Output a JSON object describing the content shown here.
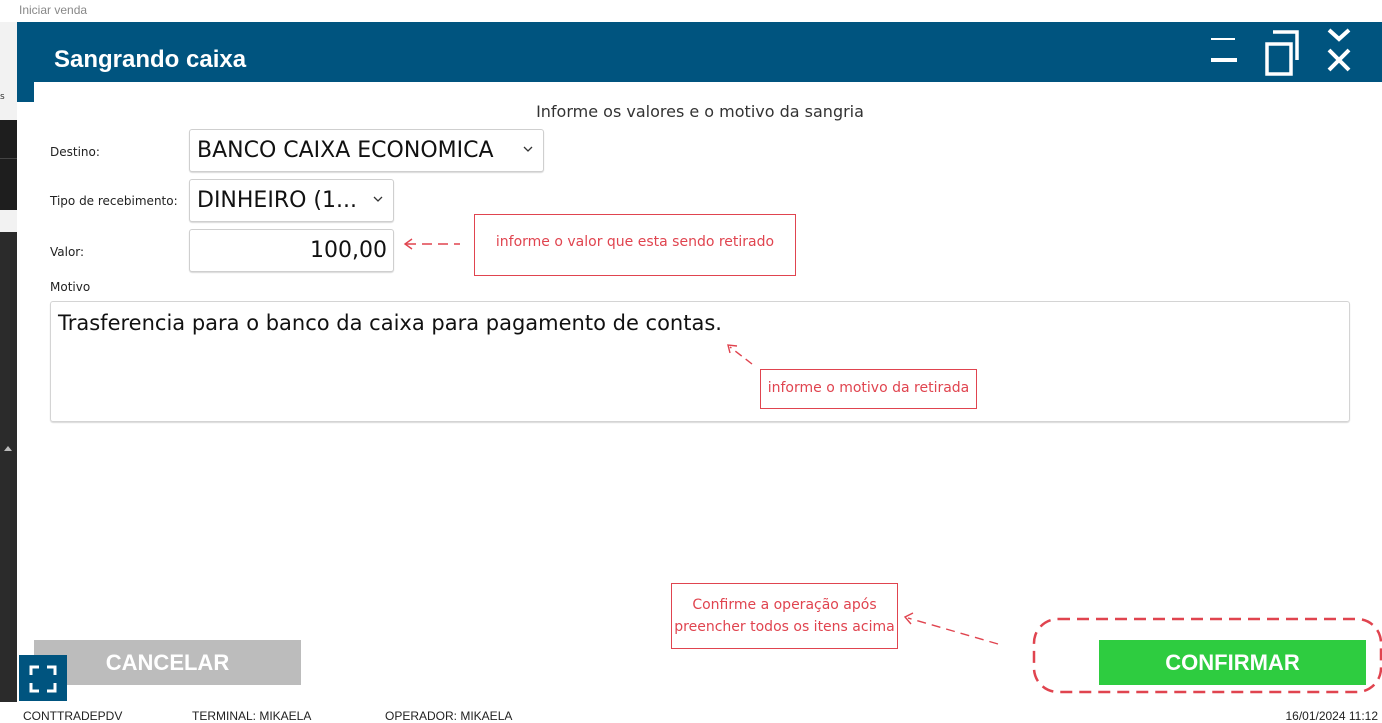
{
  "background": {
    "window_title": "Iniciar venda"
  },
  "dialog": {
    "title": "Sangrando caixa",
    "instruction": "Informe os valores e o motivo da sangria",
    "fields": {
      "destino": {
        "label": "Destino:",
        "value": "BANCO CAIXA ECONOMICA"
      },
      "tipo": {
        "label": "Tipo de recebimento:",
        "value": "DINHEIRO (1..."
      },
      "valor": {
        "label": "Valor:",
        "value": "100,00"
      },
      "motivo": {
        "label": "Motivo",
        "value": "Trasferencia para o banco da caixa para pagamento de contas."
      }
    },
    "buttons": {
      "cancel": "CANCELAR",
      "confirm": "CONFIRMAR"
    }
  },
  "annotations": {
    "valor_note": "informe o valor que esta sendo retirado",
    "motivo_note": "informe o motivo da retirada",
    "confirm_note_line1": "Confirme a operação após",
    "confirm_note_line2": "preencher todos os itens acima"
  },
  "statusbar": {
    "app": "CONTTRADEPDV",
    "terminal": "TERMINAL: MIKAELA",
    "operador": "OPERADOR: MIKAELA",
    "datetime": "16/01/2024 11:12"
  },
  "colors": {
    "header": "#00547f",
    "confirm": "#2ecc40",
    "cancel": "#bcbcbc",
    "annotation": "#e0444f"
  },
  "icons": [
    "minimize-icon",
    "restore-icon",
    "close-icon",
    "chevron-down-icon",
    "fullscreen-icon"
  ]
}
